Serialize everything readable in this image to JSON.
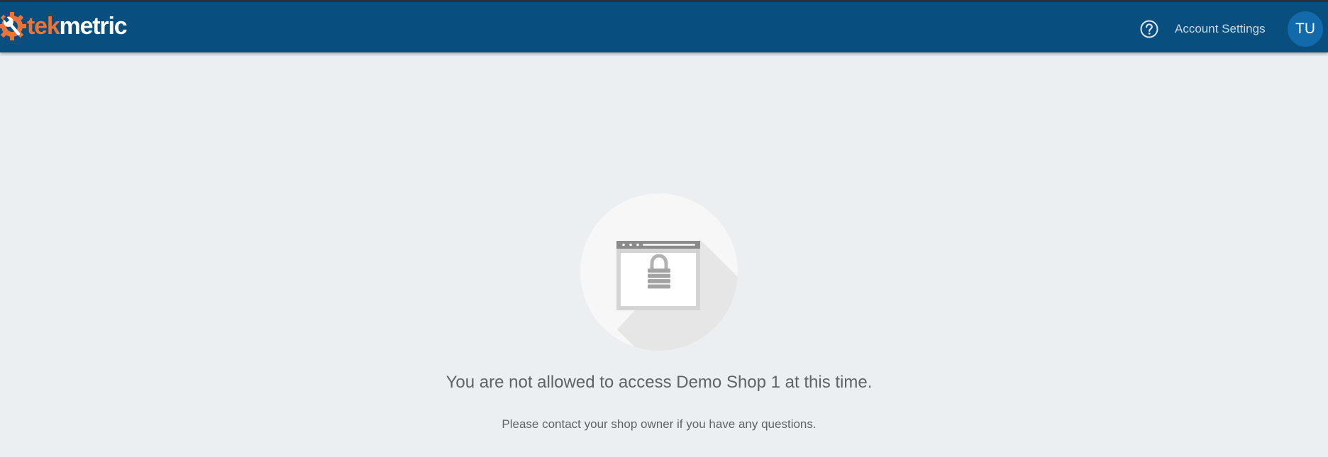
{
  "header": {
    "logo": {
      "part1": "tek",
      "part2": "metric"
    },
    "help_icon": "question-circle-icon",
    "account_settings_label": "Account Settings",
    "avatar_initials": "TU"
  },
  "main": {
    "illustration_icon": "locked-browser-icon",
    "message": "You are not allowed to access Demo Shop 1 at this time.",
    "submessage": "Please contact your shop owner if you have any questions."
  },
  "colors": {
    "header_bg": "#084f80",
    "brand_orange": "#e8743a",
    "avatar_bg": "#126aab",
    "page_bg": "#eceff1"
  }
}
